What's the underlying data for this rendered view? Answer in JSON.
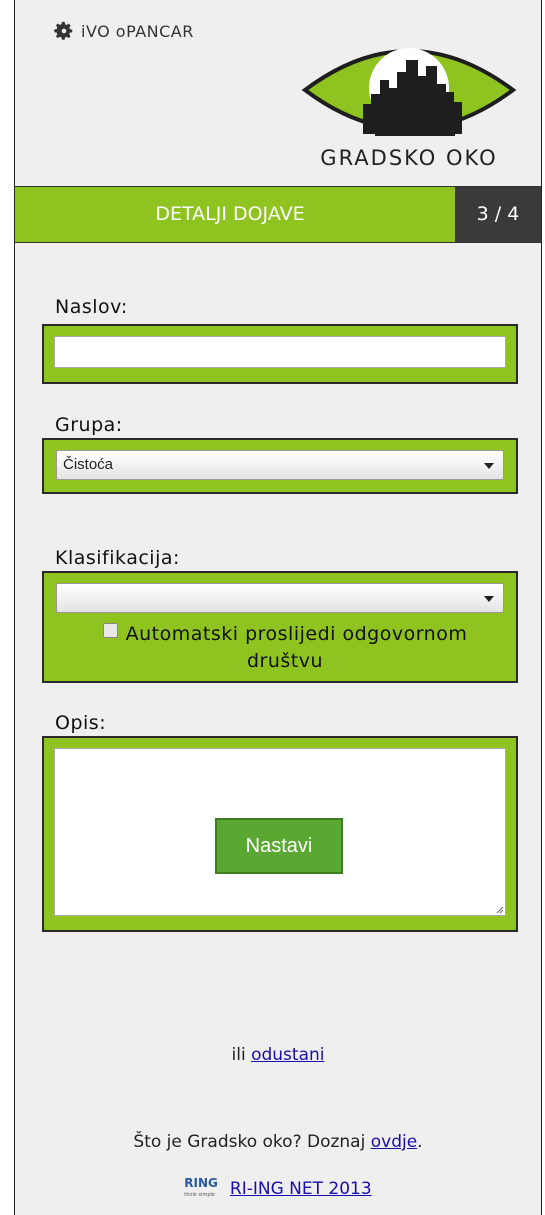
{
  "header": {
    "user_name": "iVO oPANCAR",
    "brand": "GRADSKO OKO",
    "brand_colors": {
      "green": "#8fc31f",
      "dark": "#2a2a2a"
    }
  },
  "step": {
    "title": "DETALJI DOJAVE",
    "counter": "3 / 4"
  },
  "form": {
    "naslov_label": "Naslov:",
    "naslov_value": "",
    "grupa_label": "Grupa:",
    "grupa_value": "Čistoća",
    "klasifikacija_label": "Klasifikacija:",
    "klasifikacija_value": "",
    "auto_forward_label": "Automatski proslijedi odgovornom društvu",
    "auto_forward_checked": false,
    "opis_label": "Opis:",
    "opis_value": ""
  },
  "actions": {
    "submit_label": "Nastavi",
    "cancel_prefix": "ili",
    "cancel_link": "odustani"
  },
  "info": {
    "text": "Što je Gradsko oko? Doznaj",
    "link": "ovdje",
    "suffix": "."
  },
  "footer": {
    "logo_text": "RING",
    "logo_subtext": "think simple",
    "link": "RI-ING NET 2013"
  }
}
